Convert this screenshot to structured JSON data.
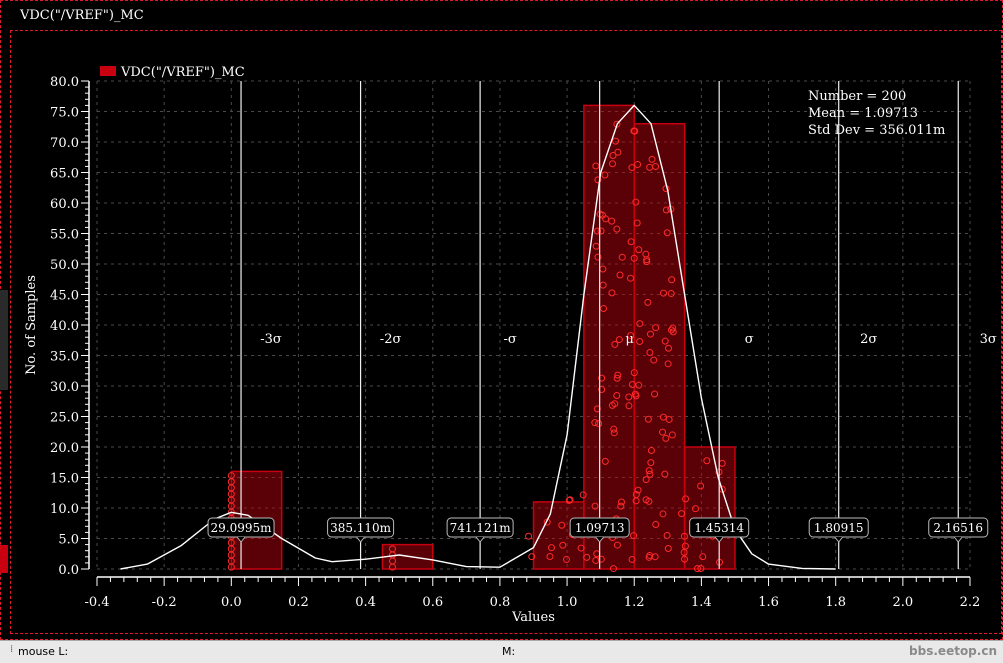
{
  "window": {
    "title": "VDC(\"/VREF\")_MC"
  },
  "status_bar": {
    "mouse_l_label": "mouse L:",
    "m_label": "M:",
    "watermark": "bbs.eetop.cn"
  },
  "colors": {
    "background": "#000000",
    "bar": "#c8000f",
    "dot": "#ff2a2a",
    "curve": "#ffffff",
    "border": "#e0192b"
  },
  "chart_data": {
    "type": "bar",
    "title": "",
    "xlabel": "Values",
    "ylabel": "No. of Samples",
    "xlim": [
      -0.4,
      2.2
    ],
    "ylim": [
      0,
      80
    ],
    "x_ticks": [
      "-0.4",
      "-0.2",
      "0.0",
      "0.2",
      "0.4",
      "0.6",
      "0.8",
      "1.0",
      "1.2",
      "1.4",
      "1.6",
      "1.8",
      "2.0",
      "2.2"
    ],
    "y_ticks": [
      "0.0",
      "5.0",
      "10.0",
      "15.0",
      "20.0",
      "25.0",
      "30.0",
      "35.0",
      "40.0",
      "45.0",
      "50.0",
      "55.0",
      "60.0",
      "65.0",
      "70.0",
      "75.0",
      "80.0"
    ],
    "legend": {
      "label": "VDC(\"/VREF\")_MC",
      "placement": "top-left"
    },
    "series": [
      {
        "name": "VDC(\"/VREF\")_MC",
        "bins": [
          {
            "x0": 0.0,
            "x1": 0.15,
            "count": 16
          },
          {
            "x0": 0.45,
            "x1": 0.6,
            "count": 4
          },
          {
            "x0": 0.9,
            "x1": 1.05,
            "count": 11
          },
          {
            "x0": 1.05,
            "x1": 1.2,
            "count": 76
          },
          {
            "x0": 1.2,
            "x1": 1.35,
            "count": 73
          },
          {
            "x0": 1.35,
            "x1": 1.5,
            "count": 20
          }
        ]
      }
    ],
    "stats": {
      "number": "Number = 200",
      "mean": "Mean = 1.09713",
      "std_dev": "Std Dev = 356.011m"
    },
    "sigma_lines": [
      {
        "label": "-3σ",
        "x": 0.029
      },
      {
        "label": "-2σ",
        "x": 0.385
      },
      {
        "label": "-σ",
        "x": 0.741
      },
      {
        "label": "μ",
        "x": 1.097
      },
      {
        "label": "σ",
        "x": 1.453
      },
      {
        "label": "2σ",
        "x": 1.809
      },
      {
        "label": "3σ",
        "x": 2.165
      }
    ],
    "value_labels": [
      {
        "text": "29.0995m",
        "x": 0.029
      },
      {
        "text": "385.110m",
        "x": 0.385
      },
      {
        "text": "741.121m",
        "x": 0.741
      },
      {
        "text": "1.09713",
        "x": 1.097
      },
      {
        "text": "1.45314",
        "x": 1.453
      },
      {
        "text": "1.80915",
        "x": 1.809
      },
      {
        "text": "2.16516",
        "x": 2.165
      }
    ],
    "density_curve": {
      "x": [
        -0.33,
        -0.25,
        -0.15,
        -0.05,
        0.0,
        0.05,
        0.15,
        0.25,
        0.3,
        0.4,
        0.5,
        0.6,
        0.7,
        0.8,
        0.9,
        0.95,
        1.0,
        1.05,
        1.1,
        1.15,
        1.2,
        1.25,
        1.3,
        1.35,
        1.4,
        1.45,
        1.5,
        1.55,
        1.6,
        1.7,
        1.8
      ],
      "y": [
        0.0,
        0.8,
        3.8,
        8.2,
        9.3,
        8.8,
        5.0,
        1.8,
        1.2,
        1.6,
        2.3,
        1.5,
        0.4,
        0.3,
        3.5,
        9.0,
        22.0,
        45.0,
        65.0,
        73.0,
        76.0,
        73.0,
        62.0,
        45.0,
        28.0,
        15.0,
        6.5,
        2.5,
        0.8,
        0.1,
        0.0
      ]
    },
    "samples": {
      "columns": [
        {
          "x": 0.0,
          "count": 16
        },
        {
          "x": 0.48,
          "count": 4
        },
        {
          "x": 0.9,
          "count": 2
        },
        {
          "x": 0.95,
          "count": 3
        },
        {
          "x": 1.0,
          "count": 6
        },
        {
          "x": 1.05,
          "count": 5
        },
        {
          "x": 1.1,
          "count": 23
        },
        {
          "x": 1.15,
          "count": 26
        },
        {
          "x": 1.2,
          "count": 25
        },
        {
          "x": 1.25,
          "count": 24
        },
        {
          "x": 1.3,
          "count": 22
        },
        {
          "x": 1.35,
          "count": 6
        },
        {
          "x": 1.4,
          "count": 7
        },
        {
          "x": 1.45,
          "count": 6
        }
      ]
    }
  }
}
